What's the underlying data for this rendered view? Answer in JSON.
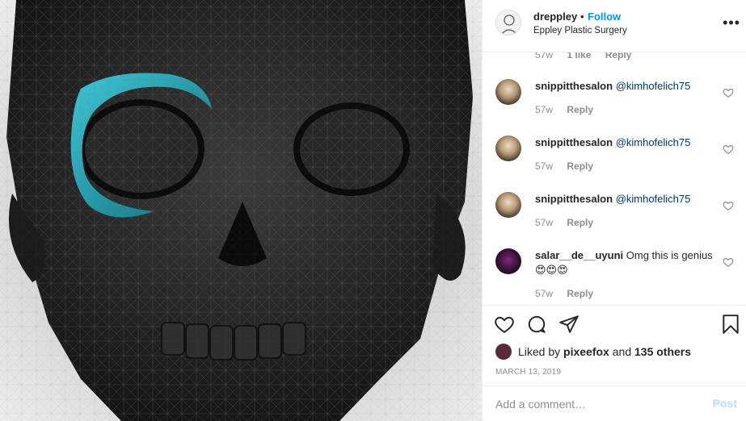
{
  "post": {
    "username": "dreppley",
    "separator": "•",
    "follow_label": "Follow",
    "location": "Eppley Plastic Surgery",
    "more_icon": "more-horizontal-icon"
  },
  "partial_comment": {
    "time": "57w",
    "likes": "1 like",
    "reply_label": "Reply"
  },
  "comments": [
    {
      "user": "snippitthesalon",
      "mention": "@kimhofelich75",
      "text": "",
      "time": "57w",
      "reply_label": "Reply"
    },
    {
      "user": "snippitthesalon",
      "mention": "@kimhofelich75",
      "text": "",
      "time": "57w",
      "reply_label": "Reply"
    },
    {
      "user": "snippitthesalon",
      "mention": "@kimhofelich75",
      "text": "",
      "time": "57w",
      "reply_label": "Reply"
    },
    {
      "user": "salar__de__uyuni",
      "mention": "",
      "text": "Omg this is genius 😍😍😍",
      "time": "57w",
      "reply_label": "Reply"
    }
  ],
  "actions": {
    "like_icon": "heart-icon",
    "comment_icon": "comment-icon",
    "share_icon": "share-icon",
    "save_icon": "bookmark-icon"
  },
  "likes": {
    "prefix": "Liked by",
    "user": "pixeefox",
    "conj": "and",
    "others": "135 others"
  },
  "date": "MARCH 13, 2019",
  "add_comment": {
    "placeholder": "Add a comment…",
    "post_label": "Post"
  },
  "colors": {
    "accent": "#0095f6",
    "post_disabled": "#b2dffc",
    "mention": "#00376b",
    "muted": "#8e8e8e",
    "skull_highlight": "#1fa5b5"
  }
}
